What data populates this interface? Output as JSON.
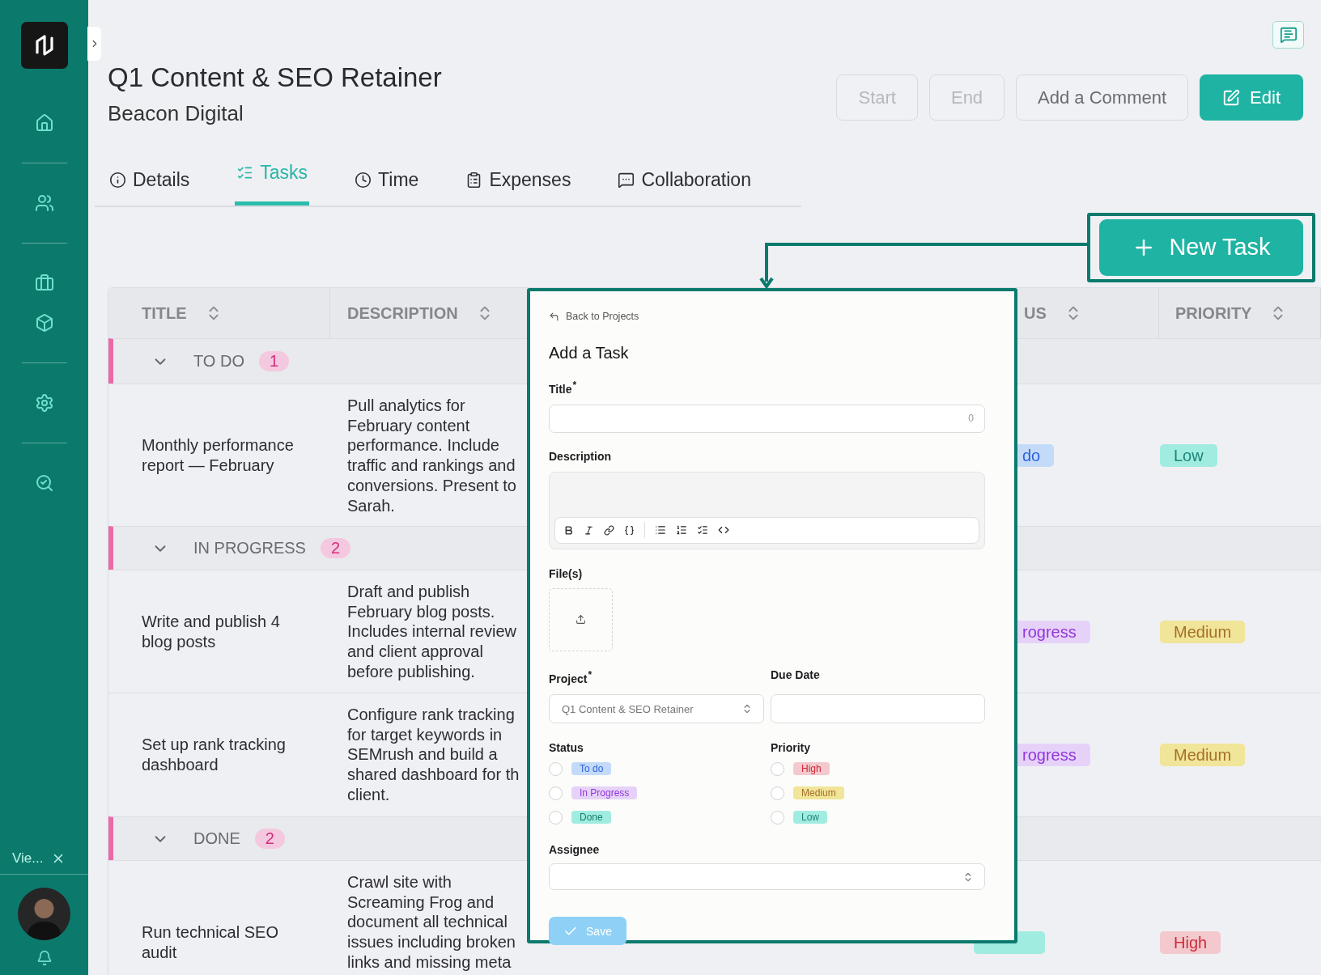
{
  "sidebar": {
    "view_label": "Vie..."
  },
  "header": {
    "title": "Q1 Content & SEO Retainer",
    "subtitle": "Beacon Digital"
  },
  "actions": [
    {
      "label": "Start",
      "kind": "outline",
      "disabled": true
    },
    {
      "label": "End",
      "kind": "outline",
      "disabled": true
    },
    {
      "label": "Add a Comment",
      "kind": "outline",
      "disabled": false
    },
    {
      "label": "Edit",
      "kind": "primary",
      "disabled": false
    }
  ],
  "tabs": [
    {
      "label": "Details",
      "selected": false
    },
    {
      "label": "Tasks",
      "selected": true
    },
    {
      "label": "Time",
      "selected": false
    },
    {
      "label": "Expenses",
      "selected": false
    },
    {
      "label": "Collaboration",
      "selected": false
    }
  ],
  "new_task_button": {
    "label": "New Task",
    "highlighted": true
  },
  "table": {
    "columns": [
      {
        "label": "TITLE"
      },
      {
        "label": "DESCRIPTION"
      },
      {
        "label": "US"
      },
      {
        "label": "PRIORITY"
      }
    ],
    "groups": [
      {
        "label": "TO DO",
        "count": "1",
        "expanded": true,
        "rows": [
          {
            "title": "Monthly performance report — February",
            "description": "Pull analytics for\nFebruary content\nperformance. Include\ntraffic and rankings and\nconversions. Present to\nSarah.",
            "status": {
              "label": "do",
              "kind": "todo"
            },
            "priority": {
              "label": "Low",
              "kind": "low"
            }
          }
        ]
      },
      {
        "label": "IN PROGRESS",
        "count": "2",
        "expanded": true,
        "rows": [
          {
            "title": "Write and publish 4 blog posts",
            "description": "Draft and publish\nFebruary blog posts.\nIncludes internal review\nand client approval\nbefore publishing.",
            "status": {
              "label": "rogress",
              "kind": "progress"
            },
            "priority": {
              "label": "Medium",
              "kind": "medium"
            }
          },
          {
            "title": "Set up rank tracking dashboard",
            "description": "Configure rank tracking\nfor target keywords in\nSEMrush and build a\nshared dashboard for th\nclient.",
            "status": {
              "label": "rogress",
              "kind": "progress"
            },
            "priority": {
              "label": "Medium",
              "kind": "medium"
            }
          }
        ]
      },
      {
        "label": "DONE",
        "count": "2",
        "expanded": true,
        "rows": [
          {
            "title": "Run technical SEO audit",
            "description": "Crawl site with\nScreaming Frog and\ndocument all technical\nissues including broken\nlinks and missing meta",
            "status": {
              "kind": "done"
            },
            "priority": {
              "label": "High",
              "kind": "high"
            }
          }
        ]
      }
    ]
  },
  "modal": {
    "back_link": "Back to Projects",
    "title": "Add a Task",
    "title_field": {
      "label": "Title",
      "required_mark": "*",
      "counter": "0"
    },
    "description_field": {
      "label": "Description"
    },
    "files_label": "File(s)",
    "project_field": {
      "label": "Project",
      "required_mark": "*",
      "value": "Q1 Content & SEO Retainer"
    },
    "due_date_field": {
      "label": "Due Date"
    },
    "status_group": {
      "label": "Status",
      "options": [
        {
          "label": "To do",
          "kind": "todo",
          "selected": false
        },
        {
          "label": "In Progress",
          "kind": "progress",
          "selected": false
        },
        {
          "label": "Done",
          "kind": "done",
          "selected": false
        }
      ]
    },
    "priority_group": {
      "label": "Priority",
      "options": [
        {
          "label": "High",
          "kind": "high",
          "selected": false
        },
        {
          "label": "Medium",
          "kind": "medium",
          "selected": false
        },
        {
          "label": "Low",
          "kind": "low",
          "selected": false
        }
      ]
    },
    "assignee_field": {
      "label": "Assignee"
    },
    "save_button": {
      "label": "Save",
      "disabled": true
    }
  }
}
